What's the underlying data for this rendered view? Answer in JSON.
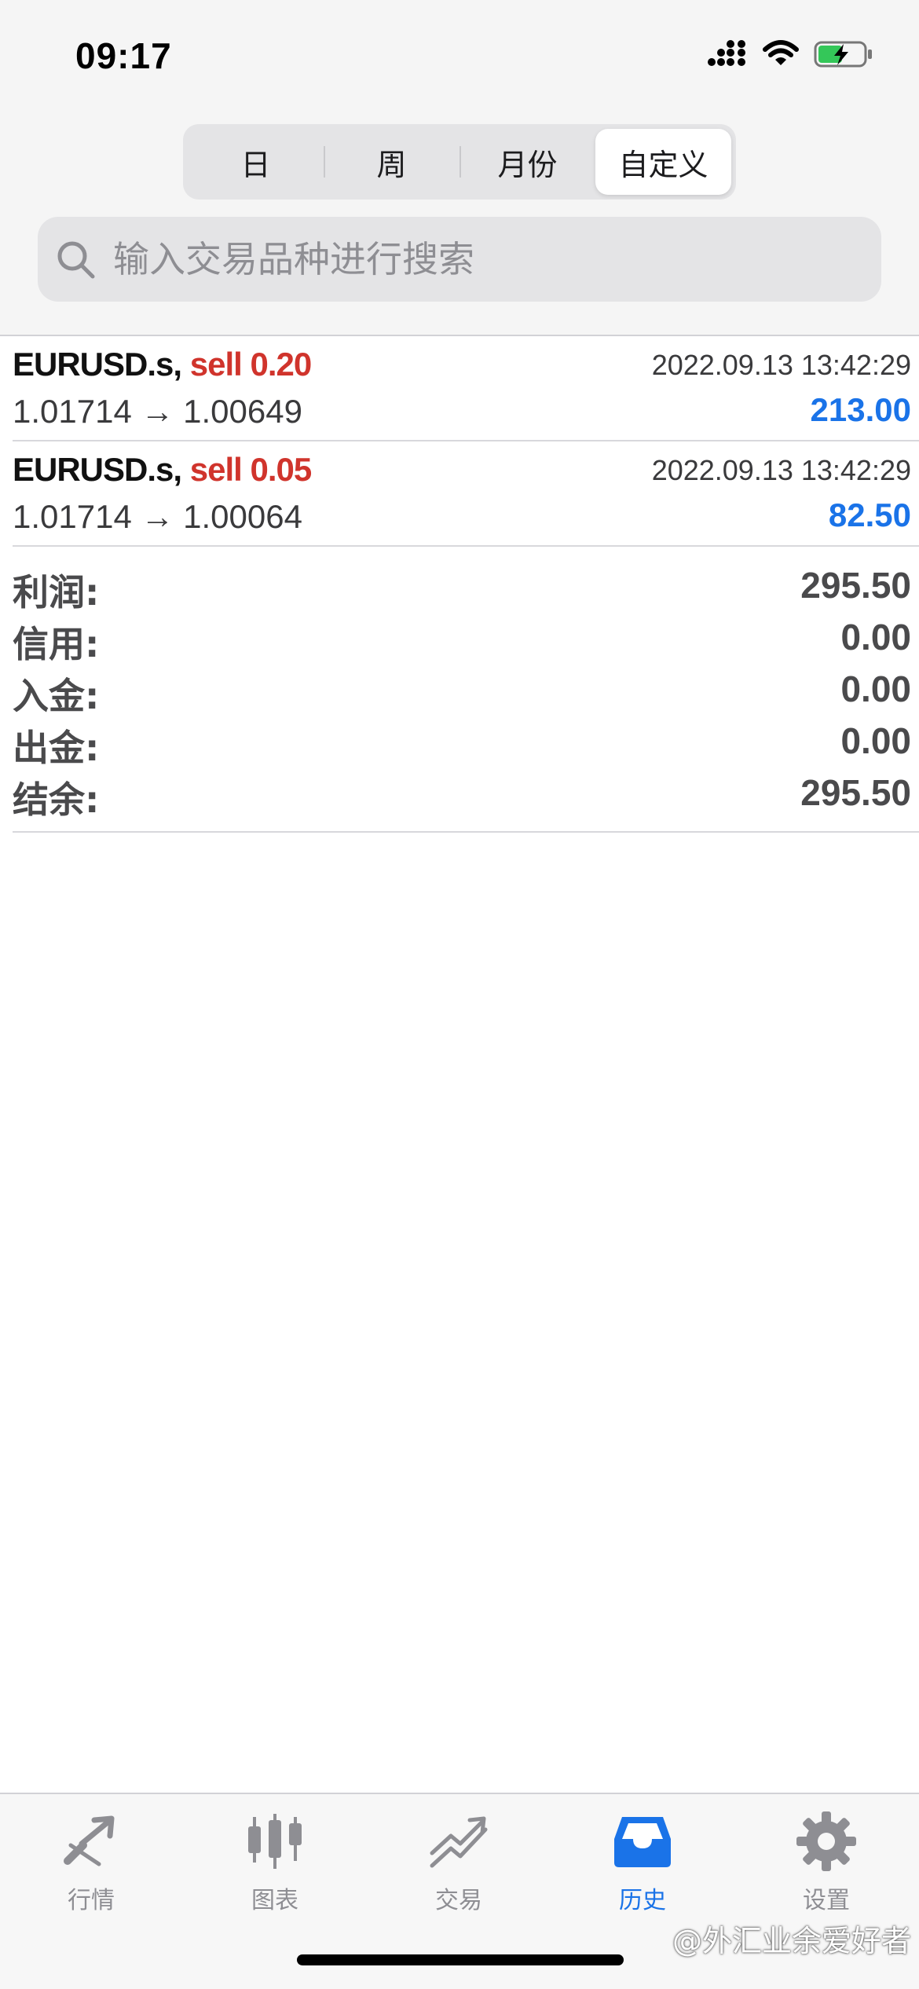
{
  "status_bar": {
    "time": "09:17"
  },
  "period_tabs": [
    {
      "label": "日",
      "active": false
    },
    {
      "label": "周",
      "active": false
    },
    {
      "label": "月份",
      "active": false
    },
    {
      "label": "自定义",
      "active": true
    }
  ],
  "search": {
    "placeholder": "输入交易品种进行搜索",
    "value": ""
  },
  "deals": [
    {
      "symbol": "EURUSD.s,",
      "side": "sell 0.20",
      "time": "2022.09.13 13:42:29",
      "prices": "1.01714 → 1.00649",
      "profit": "213.00"
    },
    {
      "symbol": "EURUSD.s,",
      "side": "sell 0.05",
      "time": "2022.09.13 13:42:29",
      "prices": "1.01714 → 1.00064",
      "profit": "82.50"
    }
  ],
  "summary": [
    {
      "label": "利润:",
      "value": "295.50"
    },
    {
      "label": "信用:",
      "value": "0.00"
    },
    {
      "label": "入金:",
      "value": "0.00"
    },
    {
      "label": "出金:",
      "value": "0.00"
    },
    {
      "label": "结余:",
      "value": "295.50"
    }
  ],
  "tabbar": [
    {
      "label": "行情",
      "icon": "quotes-icon",
      "active": false
    },
    {
      "label": "图表",
      "icon": "chart-candles-icon",
      "active": false
    },
    {
      "label": "交易",
      "icon": "trade-icon",
      "active": false
    },
    {
      "label": "历史",
      "icon": "history-inbox-icon",
      "active": true
    },
    {
      "label": "设置",
      "icon": "gear-icon",
      "active": false
    }
  ],
  "watermark": "@外汇业余爱好者",
  "colors": {
    "sell": "#d0342c",
    "profit": "#1a73e8",
    "tab_active": "#1a73e8",
    "tab_inactive": "#8e8e93"
  }
}
